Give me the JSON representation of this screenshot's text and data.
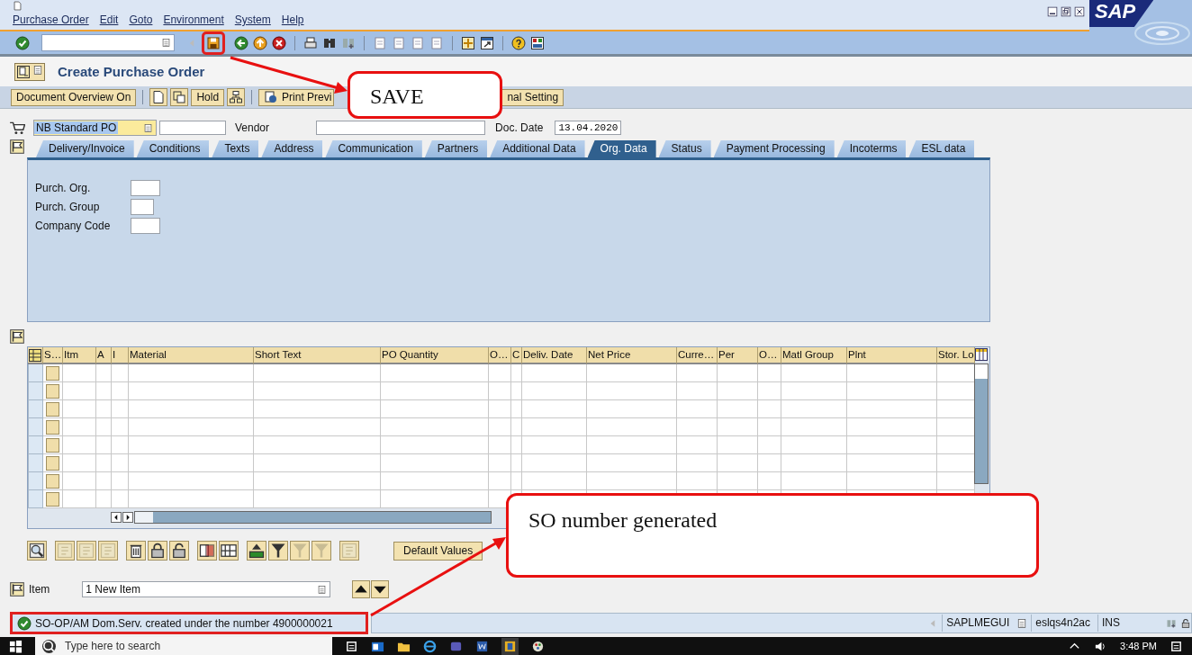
{
  "menu": [
    "Purchase Order",
    "Edit",
    "Goto",
    "Environment",
    "System",
    "Help"
  ],
  "logo": "SAP",
  "title": "Create Purchase Order",
  "app_toolbar": [
    {
      "label": "Document Overview On"
    },
    {
      "label": "Hold"
    },
    {
      "label": "Print Previ"
    },
    {
      "label": "nal Setting"
    }
  ],
  "header": {
    "doc_type": "NB Standard PO",
    "vendor_label": "Vendor",
    "doc_date_label": "Doc. Date",
    "doc_date": "13.04.2020"
  },
  "tabs": [
    {
      "label": "Delivery/Invoice",
      "selected": false
    },
    {
      "label": "Conditions",
      "selected": false
    },
    {
      "label": "Texts",
      "selected": false
    },
    {
      "label": "Address",
      "selected": false
    },
    {
      "label": "Communication",
      "selected": false
    },
    {
      "label": "Partners",
      "selected": false
    },
    {
      "label": "Additional Data",
      "selected": false
    },
    {
      "label": "Org. Data",
      "selected": true
    },
    {
      "label": "Status",
      "selected": false
    },
    {
      "label": "Payment Processing",
      "selected": false
    },
    {
      "label": "Incoterms",
      "selected": false
    },
    {
      "label": "ESL data",
      "selected": false
    }
  ],
  "org_fields": [
    {
      "label": "Purch. Org."
    },
    {
      "label": "Purch. Group"
    },
    {
      "label": "Company Code"
    }
  ],
  "items_table": {
    "columns": [
      "S…",
      "Itm",
      "A",
      "I",
      "Material",
      "Short Text",
      "PO Quantity",
      "O…",
      "C",
      "Deliv. Date",
      "Net Price",
      "Curre…",
      "Per",
      "O…",
      "Matl Group",
      "Plnt",
      "Stor. Lo"
    ]
  },
  "default_values_button": "Default Values",
  "item_selector": {
    "label": "Item",
    "value": "1 New Item"
  },
  "status_bar": {
    "message": {
      "kind": "success",
      "text": "SO-OP/AM Dom.Serv. created under the number 4900000021"
    },
    "program": "SAPLMEGUI",
    "server": "eslqs4n2ac",
    "mode": "INS"
  },
  "taskbar": {
    "search_placeholder": "Type here to search",
    "time": "3:48 PM"
  },
  "annotations": [
    {
      "text": "SAVE"
    },
    {
      "text": "SO number generated"
    }
  ]
}
